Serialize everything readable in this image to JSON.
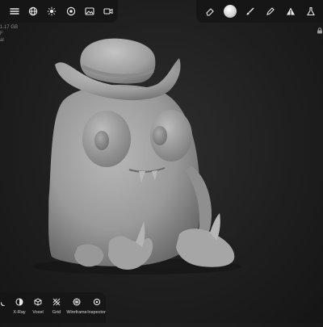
{
  "top_toolbar_left": {
    "buttons": [
      {
        "icon": "menu-icon"
      },
      {
        "icon": "globe-icon"
      },
      {
        "icon": "light-icon"
      },
      {
        "icon": "material-icon"
      },
      {
        "icon": "image-icon"
      },
      {
        "icon": "camera-icon"
      }
    ]
  },
  "top_toolbar_right": {
    "buttons": [
      {
        "icon": "eraser-icon"
      },
      {
        "icon": "material-sphere-icon",
        "active": true
      },
      {
        "icon": "brush-icon"
      },
      {
        "icon": "pen-icon"
      },
      {
        "icon": "triangle-icon"
      },
      {
        "icon": "flask-icon"
      }
    ]
  },
  "info_panel": {
    "line1": "1.17 GB",
    "line2": "F",
    "line3": "al"
  },
  "bottom_toolbar": {
    "items": [
      {
        "label": "",
        "icon": "partial-icon"
      },
      {
        "label": "X-Ray",
        "icon": "xray-icon"
      },
      {
        "label": "Voxel",
        "icon": "voxel-icon"
      },
      {
        "label": "Grid",
        "icon": "grid-icon"
      },
      {
        "label": "Wireframe",
        "icon": "wireframe-icon"
      },
      {
        "label": "Inspector",
        "icon": "inspector-icon"
      }
    ]
  },
  "colors": {
    "toolbar_bg": "#161616",
    "icon": "#e8e8e8",
    "model": "#9a9a9a"
  }
}
